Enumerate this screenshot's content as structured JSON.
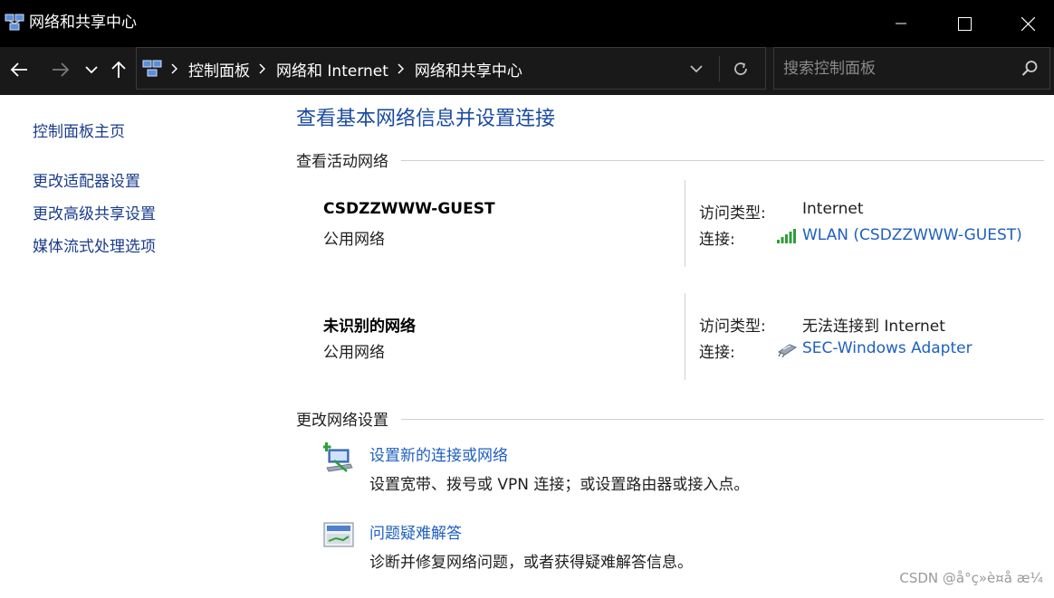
{
  "window": {
    "title": "网络和共享中心"
  },
  "address_bar": {
    "crumbs": [
      "控制面板",
      "网络和 Internet",
      "网络和共享中心"
    ]
  },
  "search": {
    "placeholder": "搜索控制面板"
  },
  "left_pane": {
    "home": "控制面板主页",
    "links": [
      "更改适配器设置",
      "更改高级共享设置",
      "媒体流式处理选项"
    ]
  },
  "main": {
    "title": "查看基本网络信息并设置连接",
    "active_networks_heading": "查看活动网络",
    "networks": [
      {
        "name": "CSDZZWWW-GUEST",
        "type": "公用网络",
        "access_label": "访问类型:",
        "access_value": "Internet",
        "conn_label": "连接:",
        "conn_value": "WLAN (CSDZZWWW-GUEST)",
        "conn_icon": "wifi-signal-icon"
      },
      {
        "name": "未识别的网络",
        "type": "公用网络",
        "access_label": "访问类型:",
        "access_value": "无法连接到 Internet",
        "conn_label": "连接:",
        "conn_value": "SEC-Windows Adapter",
        "conn_icon": "ethernet-adapter-icon"
      }
    ],
    "change_settings_heading": "更改网络设置",
    "tasks": [
      {
        "title": "设置新的连接或网络",
        "desc": "设置宽带、拨号或 VPN 连接；或设置路由器或接入点。",
        "icon": "new-connection-icon"
      },
      {
        "title": "问题疑难解答",
        "desc": "诊断并修复网络问题，或者获得疑难解答信息。",
        "icon": "troubleshoot-icon"
      }
    ]
  },
  "watermark": "CSDN @å°ç»è¤å æ¼",
  "colors": {
    "titlebar_bg": "#000000",
    "navbar_bg": "#191919",
    "link_blue": "#1f5fbf",
    "title_blue": "#1a4ba0",
    "wifi_green": "#2e9e3a"
  }
}
